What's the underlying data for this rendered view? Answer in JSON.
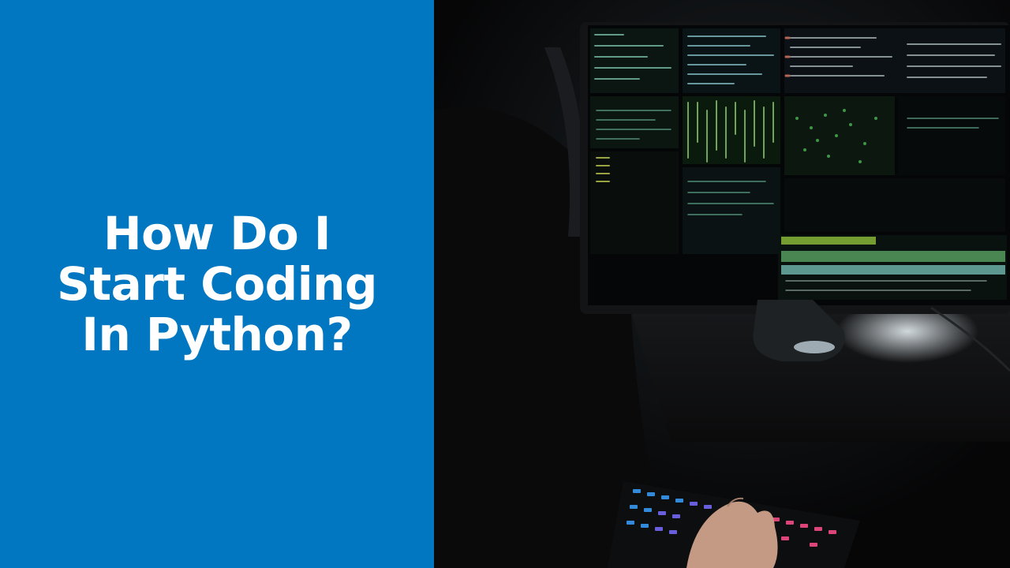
{
  "colors": {
    "panel_blue": "#0077c0",
    "title_text": "#ffffff",
    "photo_background": "#070708"
  },
  "title": {
    "lines": [
      "How Do I",
      "Start Coding",
      "In Python?"
    ]
  },
  "photo": {
    "subject": "image"
  }
}
